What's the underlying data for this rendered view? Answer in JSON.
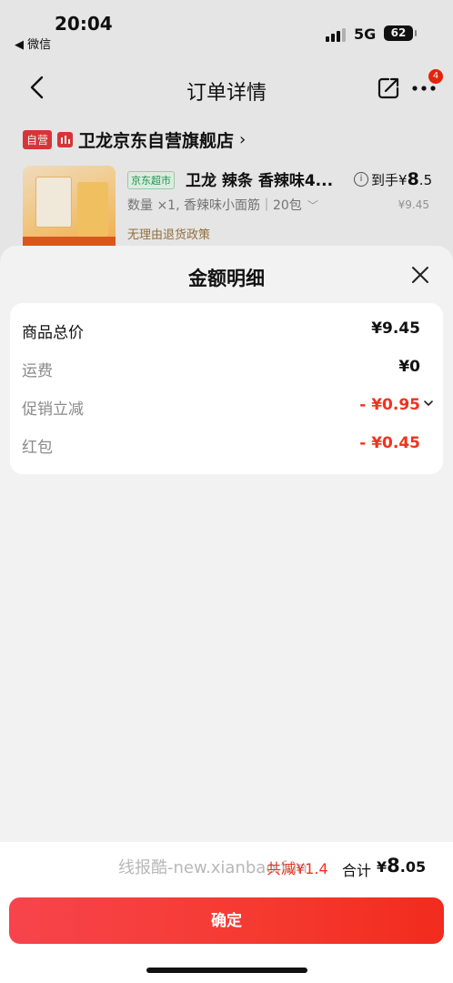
{
  "status_bar": {
    "time": "20:04",
    "back_app": "◀ 微信",
    "network": "5G",
    "battery": "62"
  },
  "background_order": {
    "ghost_line1": "订单",
    "ghost_line2": "",
    "nav_title": "订单详情",
    "more_badge": "4",
    "store_tag": "自营",
    "store_name": "卫龙京东自营旗舰店",
    "store_arrow": "›",
    "market_tag": "京东超市",
    "product_title": "卫龙 辣条 香辣味4...",
    "product_spec": "数量 ×1, 香辣味小面筋｜20包",
    "product_policy": "无理由退货政策",
    "final_price_label": "到手",
    "final_price_currency": "¥",
    "final_price_int": "8",
    "final_price_dec": ".5",
    "original_price": "¥9.45"
  },
  "sheet": {
    "title": "金额明细",
    "rows": [
      {
        "label": "商品总价",
        "value": "¥9.45"
      },
      {
        "label": "运费",
        "value": "¥0"
      },
      {
        "label": "促销立减",
        "value": "- ¥0.95"
      },
      {
        "label": "红包",
        "value": "- ¥0.45"
      }
    ]
  },
  "footer": {
    "watermark": "线报酷-new.xianbao.fun",
    "saved": "共减¥1.4",
    "total_label": "合计",
    "total_currency": "¥",
    "total_int": "8",
    "total_dec": ".05",
    "confirm_label": "确定"
  },
  "colors": {
    "accent_red": "#f0321e",
    "button_gradient_start": "#f7444c",
    "button_gradient_end": "#f22b1e"
  }
}
